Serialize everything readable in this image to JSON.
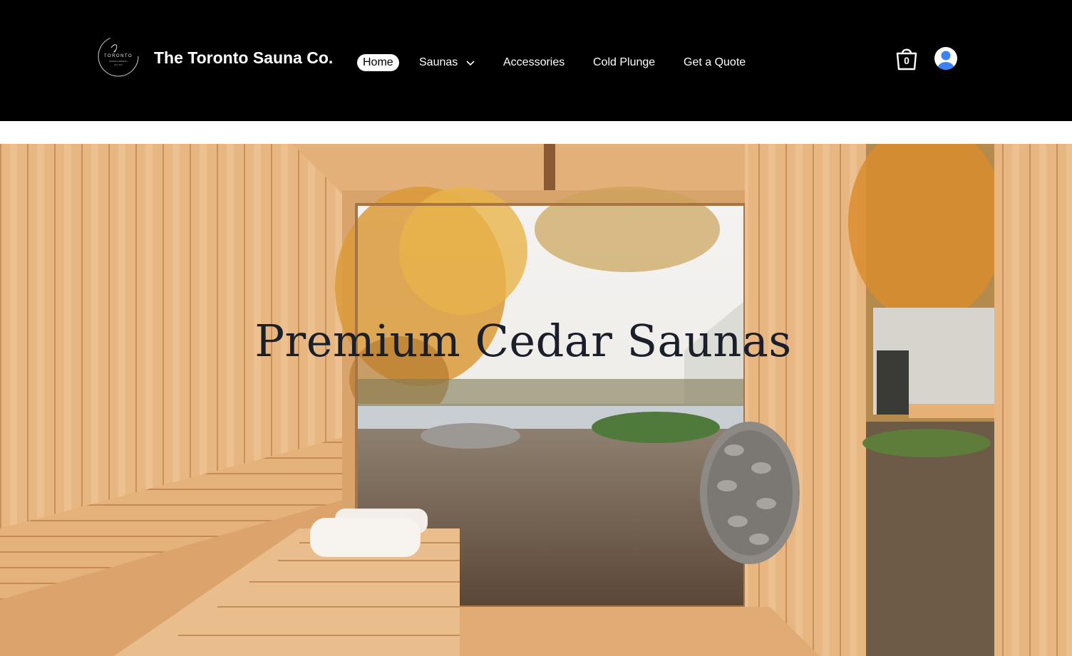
{
  "header": {
    "brand": "The Toronto Sauna Co.",
    "logo_alt": "The Toronto Sauna Company",
    "nav": [
      {
        "label": "Home",
        "active": true
      },
      {
        "label": "Saunas",
        "has_dropdown": true
      },
      {
        "label": "Accessories"
      },
      {
        "label": "Cold Plunge"
      },
      {
        "label": "Get a Quote"
      }
    ],
    "cart_count": "0",
    "icons": {
      "cart": "shopping-bag-icon",
      "account": "user-avatar-icon",
      "dropdown": "chevron-down-icon"
    }
  },
  "hero": {
    "title": "Premium Cedar Saunas",
    "image": "cedar sauna interior with window view of autumn lake"
  },
  "colors": {
    "header_bg": "#000000",
    "nav_text": "#ffffff",
    "active_pill_bg": "#ffffff",
    "avatar_blue": "#3b82f6",
    "hero_title": "#1b1f2a",
    "cedar": "#e2b07c"
  }
}
